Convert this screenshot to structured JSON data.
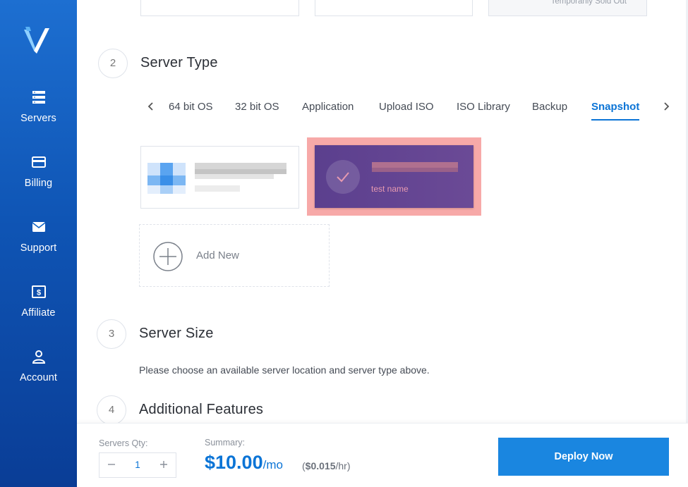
{
  "sidebar": {
    "items": [
      {
        "label": "Servers",
        "icon": "servers-icon"
      },
      {
        "label": "Billing",
        "icon": "credit-card-icon"
      },
      {
        "label": "Support",
        "icon": "envelope-icon"
      },
      {
        "label": "Affiliate",
        "icon": "dollar-bill-icon"
      },
      {
        "label": "Account",
        "icon": "user-icon"
      }
    ]
  },
  "location": {
    "sold_out_text": "Temporarily Sold Out"
  },
  "steps": {
    "server_type": {
      "number": "2",
      "title": "Server Type"
    },
    "server_size": {
      "number": "3",
      "title": "Server Size",
      "hint": "Please choose an available server location and server type above."
    },
    "additional": {
      "number": "4",
      "title": "Additional Features"
    }
  },
  "tabs": [
    "64 bit OS",
    "32 bit OS",
    "Application",
    "Upload ISO",
    "ISO Library",
    "Backup",
    "Snapshot"
  ],
  "active_tab": "Snapshot",
  "snapshots": {
    "selected_name": "test name",
    "add_new_label": "Add New"
  },
  "footer": {
    "qty_label": "Servers Qty:",
    "qty_value": "1",
    "summary_label": "Summary:",
    "price": "$10.00",
    "per_month": "/mo",
    "hourly_open": "(",
    "hourly_price": "$0.015",
    "hourly_unit": "/hr)",
    "deploy_label": "Deploy Now"
  },
  "colors": {
    "accent": "#0b74d6",
    "sidebar": "#1265c6",
    "selected_card": "#5b3f8e",
    "highlight": "#f7a9a8"
  }
}
